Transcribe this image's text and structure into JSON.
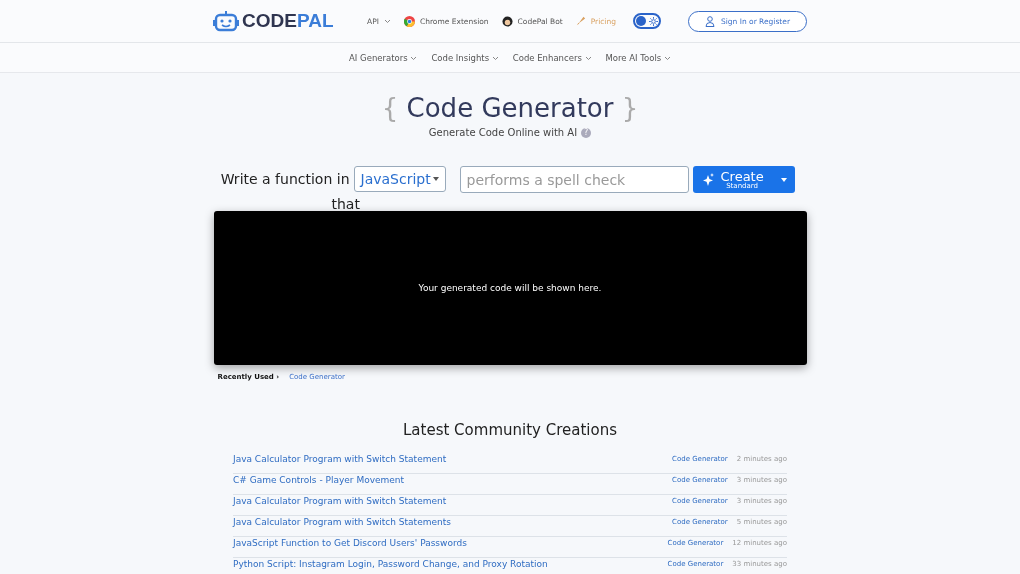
{
  "logo": [
    "CODE",
    "PAL"
  ],
  "top_nav": [
    {
      "label": "API",
      "kind": "dropdown"
    },
    {
      "label": "Chrome Extension",
      "kind": "chrome"
    },
    {
      "label": "CodePal Bot",
      "kind": "bot"
    },
    {
      "label": "Pricing",
      "kind": "pricing"
    }
  ],
  "theme_toggle": {
    "on": false
  },
  "sign_in": "Sign In or Register",
  "sub_nav": [
    "AI Generators",
    "Code Insights",
    "Code Enhancers",
    "More AI Tools"
  ],
  "title": {
    "open": "{",
    "text": "Code Generator",
    "close": "}"
  },
  "subtitle": "Generate Code Online with AI",
  "help": "?",
  "prompt": {
    "lead": "Write a function in",
    "language": "JavaScript",
    "trail": "that",
    "placeholder": "performs a spell check"
  },
  "create": {
    "label": "Create",
    "mode": "Standard"
  },
  "output_text": "Your generated code will be shown here.",
  "recently_used": {
    "label": "Recently Used ›",
    "items": [
      "Code Generator"
    ]
  },
  "community": {
    "title": "Latest Community Creations",
    "rows": [
      {
        "title": "Java Calculator Program with Switch Statement",
        "tool": "Code Generator",
        "time": "2 minutes ago"
      },
      {
        "title": "C# Game Controls - Player Movement",
        "tool": "Code Generator",
        "time": "3 minutes ago"
      },
      {
        "title": "Java Calculator Program with Switch Statement",
        "tool": "Code Generator",
        "time": "3 minutes ago"
      },
      {
        "title": "Java Calculator Program with Switch Statements",
        "tool": "Code Generator",
        "time": "5 minutes ago"
      },
      {
        "title": "JavaScript Function to Get Discord Users' Passwords",
        "tool": "Code Generator",
        "time": "12 minutes ago"
      },
      {
        "title": "Python Script: Instagram Login, Password Change, and Proxy Rotation",
        "tool": "Code Generator",
        "time": "33 minutes ago"
      }
    ]
  }
}
